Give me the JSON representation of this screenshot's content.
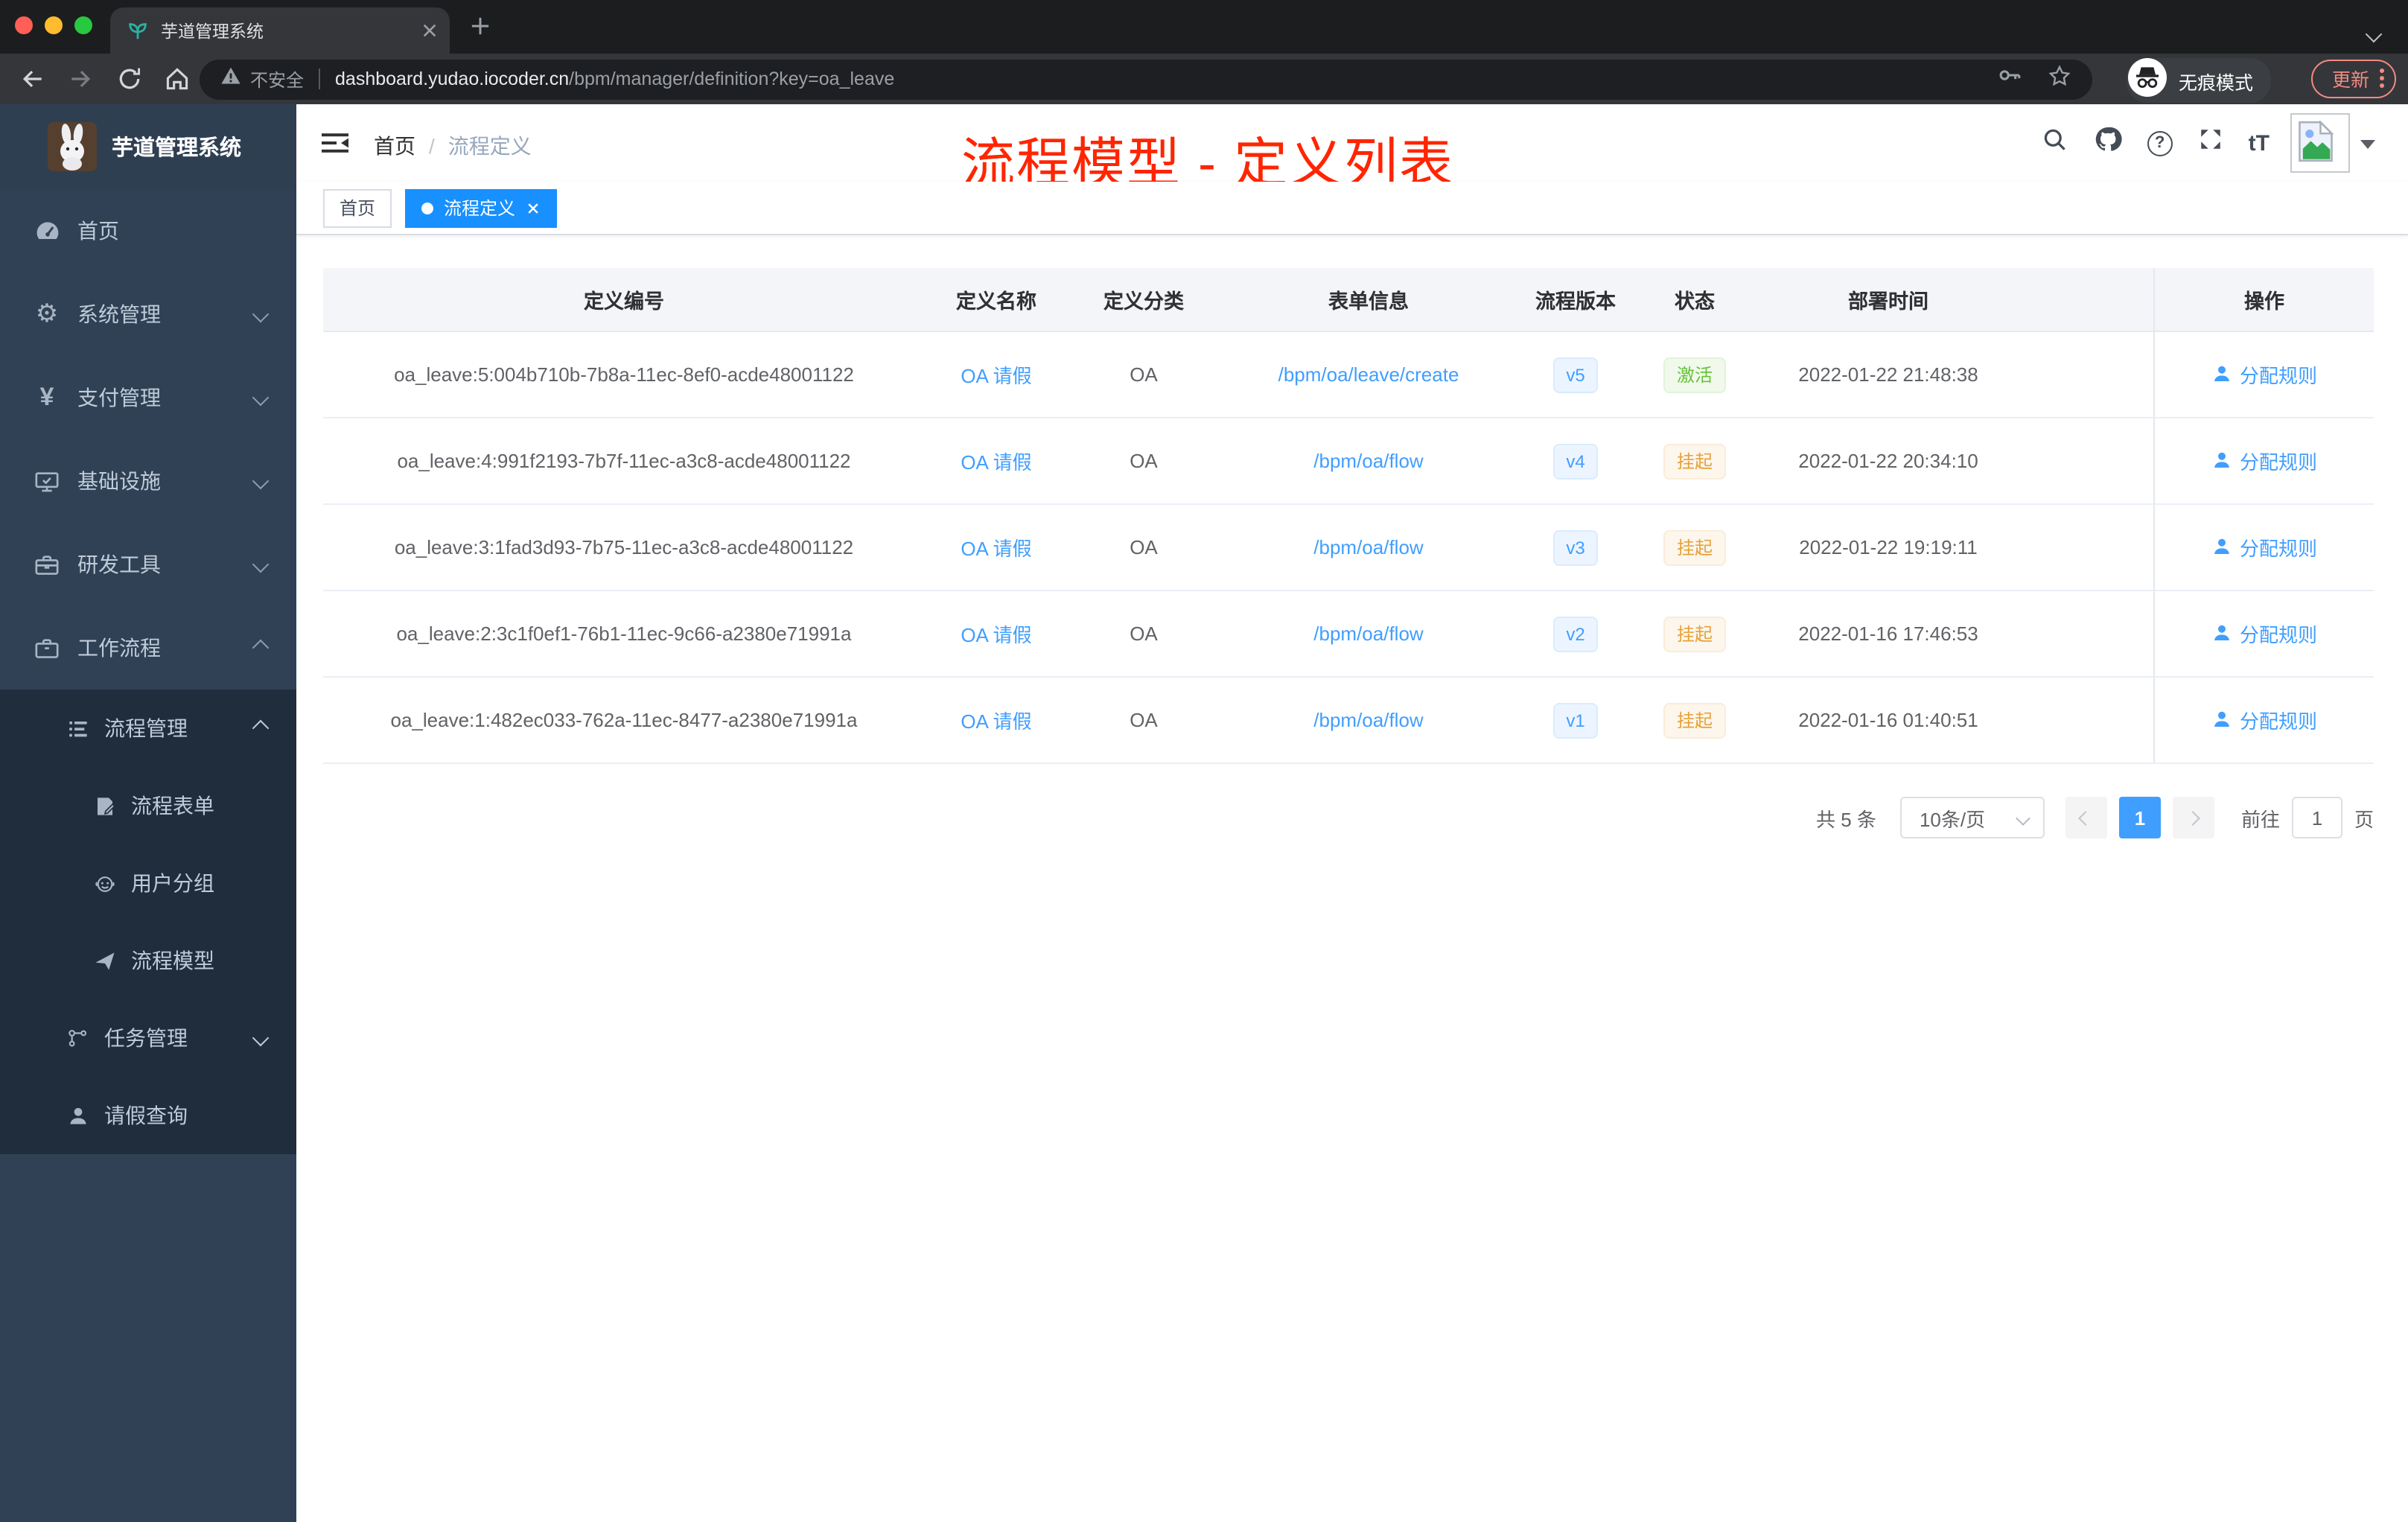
{
  "browser": {
    "tab_title": "芋道管理系统",
    "security_label": "不安全",
    "url_host": "dashboard.yudao.iocoder.cn",
    "url_path": "/bpm/manager/definition?key=oa_leave",
    "incognito_label": "无痕模式",
    "update_label": "更新"
  },
  "icons": {
    "gear_glyph": "⚙",
    "yen_glyph": "¥",
    "question_glyph": "?",
    "font_size_glyph": "tT"
  },
  "sidebar": {
    "title": "芋道管理系统",
    "items": [
      {
        "label": "首页"
      },
      {
        "label": "系统管理"
      },
      {
        "label": "支付管理"
      },
      {
        "label": "基础设施"
      },
      {
        "label": "研发工具"
      },
      {
        "label": "工作流程"
      }
    ],
    "sub_items": [
      {
        "label": "流程管理"
      },
      {
        "label": "流程表单"
      },
      {
        "label": "用户分组"
      },
      {
        "label": "流程模型"
      },
      {
        "label": "任务管理"
      },
      {
        "label": "请假查询"
      }
    ]
  },
  "header": {
    "breadcrumb": {
      "home": "首页",
      "separator": "/",
      "current": "流程定义"
    },
    "annotation": "流程模型 - 定义列表"
  },
  "tags": {
    "home": "首页",
    "active": "流程定义"
  },
  "table": {
    "columns": [
      "定义编号",
      "定义名称",
      "定义分类",
      "表单信息",
      "流程版本",
      "状态",
      "部署时间",
      "操作"
    ],
    "rows": [
      {
        "id": "oa_leave:5:004b710b-7b8a-11ec-8ef0-acde48001122",
        "name": "OA 请假",
        "category": "OA",
        "form": "/bpm/oa/leave/create",
        "version": "v5",
        "status": "激活",
        "time": "2022-01-22 21:48:38",
        "action": "分配规则"
      },
      {
        "id": "oa_leave:4:991f2193-7b7f-11ec-a3c8-acde48001122",
        "name": "OA 请假",
        "category": "OA",
        "form": "/bpm/oa/flow",
        "version": "v4",
        "status": "挂起",
        "time": "2022-01-22 20:34:10",
        "action": "分配规则"
      },
      {
        "id": "oa_leave:3:1fad3d93-7b75-11ec-a3c8-acde48001122",
        "name": "OA 请假",
        "category": "OA",
        "form": "/bpm/oa/flow",
        "version": "v3",
        "status": "挂起",
        "time": "2022-01-22 19:19:11",
        "action": "分配规则"
      },
      {
        "id": "oa_leave:2:3c1f0ef1-76b1-11ec-9c66-a2380e71991a",
        "name": "OA 请假",
        "category": "OA",
        "form": "/bpm/oa/flow",
        "version": "v2",
        "status": "挂起",
        "time": "2022-01-16 17:46:53",
        "action": "分配规则"
      },
      {
        "id": "oa_leave:1:482ec033-762a-11ec-8477-a2380e71991a",
        "name": "OA 请假",
        "category": "OA",
        "form": "/bpm/oa/flow",
        "version": "v1",
        "status": "挂起",
        "time": "2022-01-16 01:40:51",
        "action": "分配规则"
      }
    ]
  },
  "pagination": {
    "total": "共 5 条",
    "page_size": "10条/页",
    "current": "1",
    "goto_label": "前往",
    "goto_value": "1",
    "unit_label": "页"
  },
  "colors": {
    "accent": "#409eff",
    "active_tag": "#1890ff",
    "annotation_red": "#ff2500",
    "status_active_green": "#67c23a",
    "status_suspend_orange": "#e6a23c",
    "sidebar_bg": "#304156",
    "submenu_bg": "#1f2d3d"
  }
}
